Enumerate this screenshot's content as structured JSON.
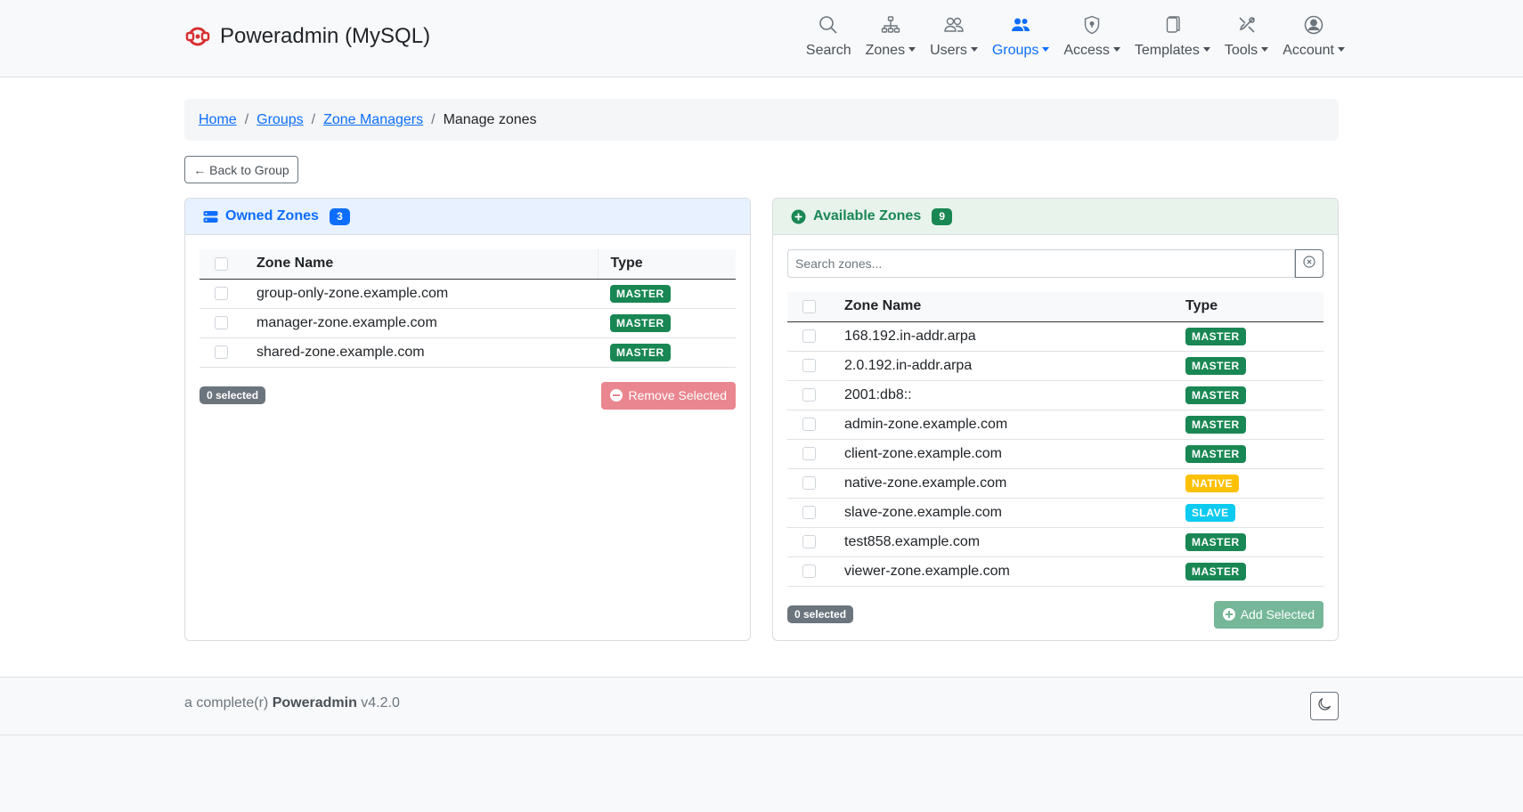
{
  "brand": {
    "title": "Poweradmin (MySQL)"
  },
  "nav": {
    "search": "Search",
    "zones": "Zones",
    "users": "Users",
    "groups": "Groups",
    "access": "Access",
    "templates": "Templates",
    "tools": "Tools",
    "account": "Account"
  },
  "breadcrumb": {
    "home": "Home",
    "groups": "Groups",
    "group": "Zone Managers",
    "current": "Manage zones",
    "separator": "/"
  },
  "back_button": "← Back to Group",
  "owned": {
    "title": "Owned Zones",
    "count": "3",
    "col_name": "Zone Name",
    "col_type": "Type",
    "rows": [
      {
        "name": "group-only-zone.example.com",
        "type": "MASTER"
      },
      {
        "name": "manager-zone.example.com",
        "type": "MASTER"
      },
      {
        "name": "shared-zone.example.com",
        "type": "MASTER"
      }
    ],
    "selected": "0 selected",
    "action": "Remove Selected"
  },
  "available": {
    "title": "Available Zones",
    "count": "9",
    "search_placeholder": "Search zones...",
    "col_name": "Zone Name",
    "col_type": "Type",
    "rows": [
      {
        "name": "168.192.in-addr.arpa",
        "type": "MASTER"
      },
      {
        "name": "2.0.192.in-addr.arpa",
        "type": "MASTER"
      },
      {
        "name": "2001:db8::",
        "type": "MASTER"
      },
      {
        "name": "admin-zone.example.com",
        "type": "MASTER"
      },
      {
        "name": "client-zone.example.com",
        "type": "MASTER"
      },
      {
        "name": "native-zone.example.com",
        "type": "NATIVE"
      },
      {
        "name": "slave-zone.example.com",
        "type": "SLAVE"
      },
      {
        "name": "test858.example.com",
        "type": "MASTER"
      },
      {
        "name": "viewer-zone.example.com",
        "type": "MASTER"
      }
    ],
    "selected": "0 selected",
    "action": "Add Selected"
  },
  "footer": {
    "prefix": "a complete(r)",
    "product": "Poweradmin",
    "version": "v4.2.0"
  },
  "colors": {
    "primary": "#0d6efd",
    "success": "#198754",
    "warning": "#ffc107",
    "info": "#0dcaf0",
    "danger_light": "#ea868f",
    "brand_red": "#d63031"
  }
}
